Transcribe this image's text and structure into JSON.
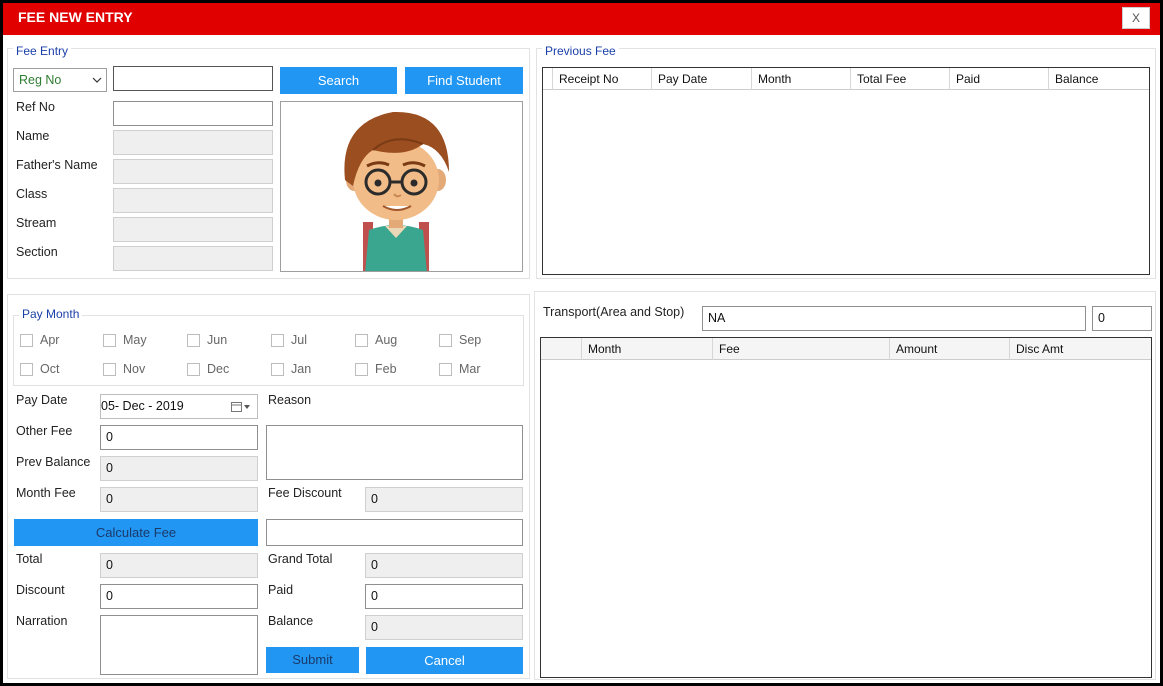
{
  "window": {
    "title": "FEE NEW ENTRY",
    "close_label": "X"
  },
  "fee_entry": {
    "legend": "Fee Entry",
    "search_by": "Reg No",
    "search_value": "",
    "search_label": "Search",
    "find_student_label": "Find Student",
    "ref_no_label": "Ref No",
    "ref_no_value": "",
    "name_label": "Name",
    "fathers_name_label": "Father's Name",
    "class_label": "Class",
    "stream_label": "Stream",
    "section_label": "Section"
  },
  "previous_fee": {
    "legend": "Previous Fee",
    "columns": [
      "Receipt No",
      "Pay Date",
      "Month",
      "Total Fee",
      "Paid",
      "Balance"
    ]
  },
  "pay_month": {
    "legend": "Pay Month",
    "months_row1": [
      "Apr",
      "May",
      "Jun",
      "Jul",
      "Aug",
      "Sep"
    ],
    "months_row2": [
      "Oct",
      "Nov",
      "Dec",
      "Jan",
      "Feb",
      "Mar"
    ]
  },
  "form": {
    "pay_date_label": "Pay Date",
    "pay_date_value": "05- Dec - 2019",
    "reason_label": "Reason",
    "reason_value": "",
    "other_fee_label": "Other Fee",
    "other_fee_value": "0",
    "prev_balance_label": "Prev Balance",
    "prev_balance_value": "0",
    "month_fee_label": "Month Fee",
    "month_fee_value": "0",
    "fee_discount_label": "Fee Discount",
    "fee_discount_value": "0",
    "calculate_label": "Calculate Fee",
    "calc_note_value": "",
    "total_label": "Total",
    "total_value": "0",
    "grand_total_label": "Grand Total",
    "grand_total_value": "0",
    "discount_label": "Discount",
    "discount_value": "0",
    "paid_label": "Paid",
    "paid_value": "0",
    "narration_label": "Narration",
    "narration_value": "",
    "balance_label": "Balance",
    "balance_value": "0",
    "submit_label": "Submit",
    "cancel_label": "Cancel"
  },
  "transport": {
    "label": "Transport(Area and Stop)",
    "area_value": "NA",
    "amount_value": "0",
    "columns": [
      "Month",
      "Fee",
      "Amount",
      "Disc Amt"
    ]
  },
  "colors": {
    "title_bar": "#e00000",
    "button": "#2196f3",
    "legend": "#1a3fa8"
  }
}
